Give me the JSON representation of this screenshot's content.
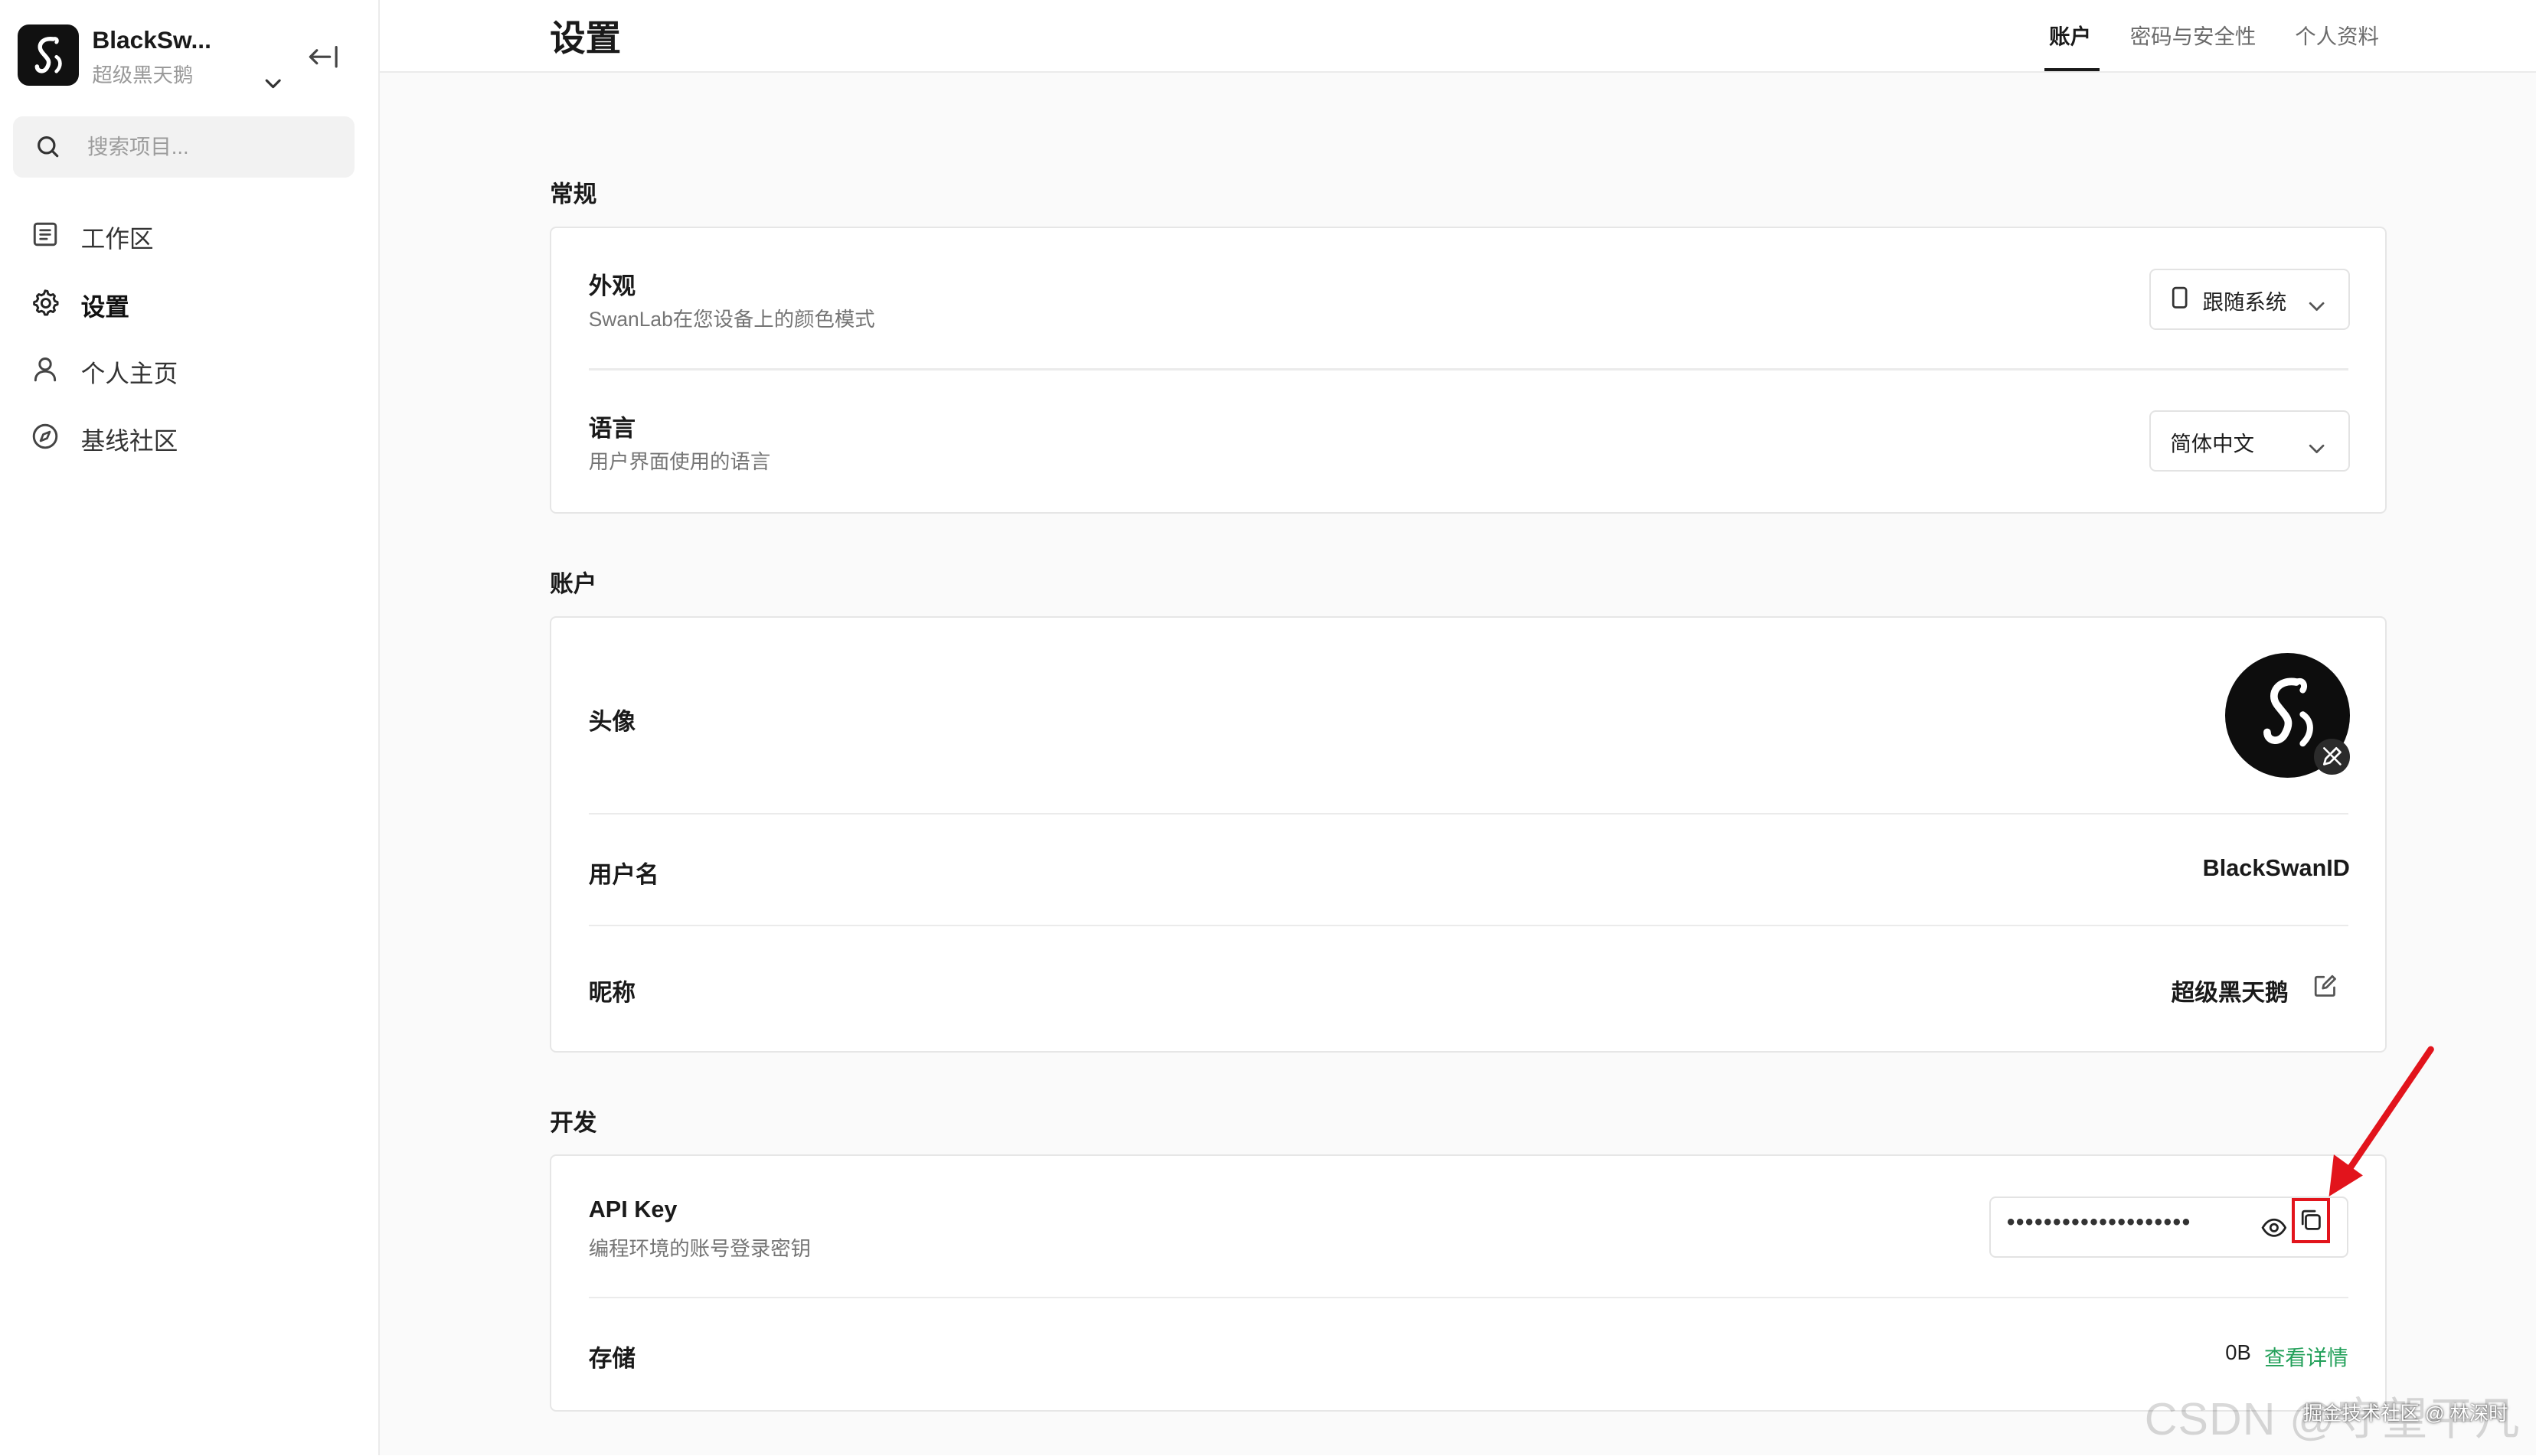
{
  "colors": {
    "accent_link": "#23a05a",
    "highlight": "#e2141c",
    "text_primary": "#1a1a1a",
    "text_secondary": "#757575"
  },
  "sidebar": {
    "workspace": {
      "name": "BlackSw...",
      "subtitle": "超级黑天鹅",
      "logo_icon": "swanlab-logo-icon",
      "chevron_icon": "chevron-down-icon"
    },
    "collapse_icon": "collapse-sidebar-icon",
    "search": {
      "placeholder": "搜索项目...",
      "value": "",
      "icon": "search-icon"
    },
    "nav_items": [
      {
        "label": "工作区",
        "icon": "document-icon",
        "active": false
      },
      {
        "label": "设置",
        "icon": "gear-icon",
        "active": true
      },
      {
        "label": "个人主页",
        "icon": "user-icon",
        "active": false
      },
      {
        "label": "基线社区",
        "icon": "compass-icon",
        "active": false
      }
    ]
  },
  "header": {
    "title": "设置",
    "tabs": [
      {
        "label": "账户",
        "active": true
      },
      {
        "label": "密码与安全性",
        "active": false
      },
      {
        "label": "个人资料",
        "active": false
      }
    ]
  },
  "general": {
    "title": "常规",
    "appearance": {
      "label": "外观",
      "description": "SwanLab在您设备上的颜色模式",
      "value": "跟随系统",
      "icon": "phone-icon"
    },
    "language": {
      "label": "语言",
      "description": "用户界面使用的语言",
      "value": "简体中文"
    }
  },
  "account": {
    "title": "账户",
    "avatar": {
      "label": "头像",
      "edit_icon": "edit-avatar-icon"
    },
    "username": {
      "label": "用户名",
      "value": "BlackSwanID"
    },
    "nickname": {
      "label": "昵称",
      "value": "超级黑天鹅",
      "edit_icon": "edit-icon"
    }
  },
  "development": {
    "title": "开发",
    "api_key": {
      "label": "API Key",
      "description": "编程环境的账号登录密钥",
      "masked_value": "••••••••••••••••••••",
      "show_icon": "eye-icon",
      "copy_icon": "copy-icon"
    },
    "storage": {
      "label": "存储",
      "value": "0B",
      "link": "查看详情"
    }
  },
  "watermark": {
    "large": "CSDN @守望平凡",
    "small": "掘金技术社区 @ 林深时"
  }
}
